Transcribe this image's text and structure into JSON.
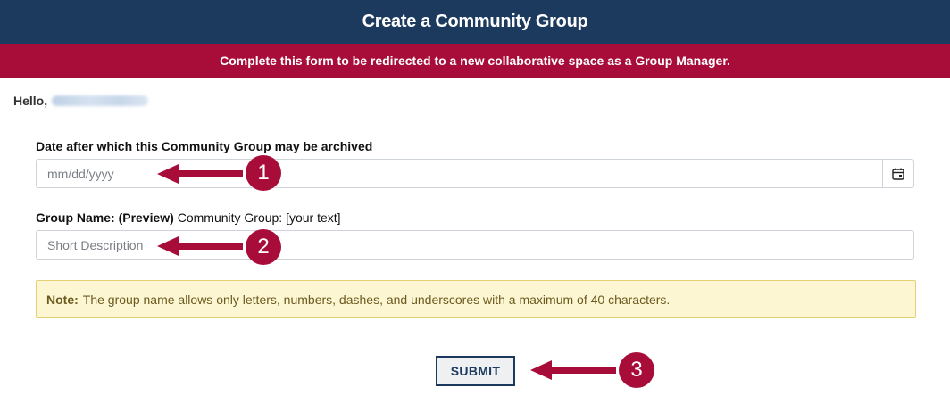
{
  "header": {
    "title": "Create a Community Group"
  },
  "banner": {
    "text": "Complete this form to be redirected to a new collaborative space as a Group Manager."
  },
  "greeting": {
    "prefix": "Hello,"
  },
  "date_field": {
    "label": "Date after which this Community Group may be archived",
    "placeholder": "mm/dd/yyyy",
    "icon": "calendar-icon"
  },
  "group_name_field": {
    "label_bold": "Group Name: (Preview)",
    "label_rest": " Community Group: [your text]",
    "placeholder": "Short Description"
  },
  "note": {
    "label": "Note:",
    "text": "The group name allows only letters, numbers, dashes, and underscores with a maximum of 40 characters."
  },
  "submit": {
    "label": "SUBMIT"
  },
  "annotations": [
    {
      "number": "1"
    },
    {
      "number": "2"
    },
    {
      "number": "3"
    }
  ],
  "colors": {
    "header_bg": "#1c3a5e",
    "banner_bg": "#a80d3a",
    "annotation": "#a80d3a",
    "note_bg": "#fdf6d2"
  }
}
